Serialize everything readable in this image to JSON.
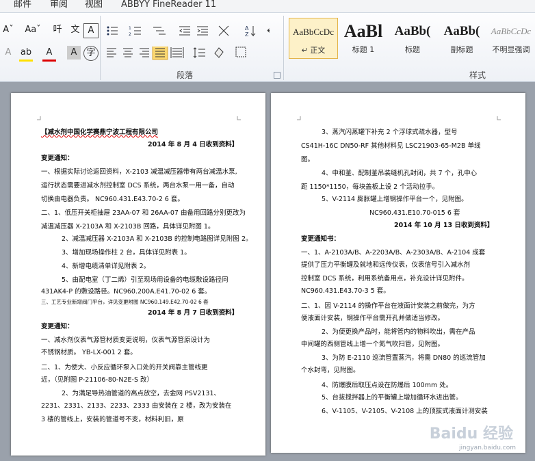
{
  "menu": [
    "邮件",
    "审阅",
    "视图",
    "ABBYY FineReader 11"
  ],
  "ribbon": {
    "font_row1": [
      "Aˇ",
      "Aaˇ",
      "吀",
      "文",
      "A"
    ],
    "font_row2": [
      "A",
      "ab",
      "A",
      "A",
      "字"
    ],
    "paragraph_label": "段落",
    "styles_label": "样式",
    "styles": [
      {
        "preview": "AaBbCcDc",
        "name": "↵ 正文"
      },
      {
        "preview": "AaBl",
        "name": "标题 1"
      },
      {
        "preview": "AaBb(",
        "name": "标题"
      },
      {
        "preview": "AaBb(",
        "name": "副标题"
      },
      {
        "preview": "AaBbCcDc",
        "name": "不明显强调"
      }
    ]
  },
  "left_page": {
    "lines": [
      "【减水剂中国化学赛鼎宁波工程有限公司",
      "2014 年 8 月 4 日收到资料】",
      "变更通知：",
      "一、根据实际讨论返回资料，X-2103 减温减压器带有两台减温水泵,",
      "运行状态需要进减水剂控制室 DCS 系统，两台水泵一用一备，自动",
      "切换由电器负责。            NC960.431.E43.70-2       6 套。",
      "二、1、低压开关柜抽屉 23AA-07 和 26AA-07 由备用回路分别更改为",
      "减温减压器 X-2103A 和 X-2103B 回路，具体详见附图 1。",
      "2、减温减压器 X-2103A 和 X-2103B 的控制电路图详见附图 2。",
      "3、增加现场操作柱 2 台，具体详见附表 1。",
      "4、新增电缆清单详见附表 2。",
      "5、由配电室（丁二烯）引至现场用设备的电缆敷设路径同",
      "431AK4-P 的敷设路径。NC960.200A.E41.70-02    6 套。",
      "三、工艺专业新增阀门平台，详见变更附图     NC960.149.E42.70-02   6 套",
      "2014 年 8 月 7 日收到资料】",
      "变更通知：",
      "一、减水剂仪表气源管材质变更说明，仪表气源管原设计为",
      "不锈钢材质。                YB-LX-001            2 套。",
      "二、1、为使大、小反应循环泵入口处的开关阀靠主管线更",
      "近，（见附图 P-21106-80-N2E-S 改）",
      "2、为满足导热油管道的高点放空，去金网  PSV2131、",
      "2231、2331、2133、2233、2333 由安装在 2 楼，改为安装在",
      "3  楼的管线上，安装的管道号不变，材料利旧，原"
    ]
  },
  "right_page": {
    "lines": [
      "3、蒸汽闪蒸罐下补充 2 个浮球式疏水器，型号",
      "CS41H-16C DN50-RF 其他材料见 LSC21903-65-M2B 单线",
      "图。",
      "4、中和釜、配制釜吊装缝机孔封闭，共 7 个，孔中心",
      "距 1150*1150，每块盖板上设 2 个活动拉手。",
      "5、V-2114 膨胀罐上增钢操作平台一个，见附图。",
      "NC960.431.E10.70-015            6 套",
      "2014 年 10 月 13 日收到资料】",
      "变更通知书：",
      "一、1、A-2103A/B、A-2203A/B、A-2303A/B、A-2104 成套",
      "提供了压力平衡罐及就地和远传仪表，仪表信号引入减水剂",
      "控制室  DCS  系统，利用系统备用点，补充设计详见附件。",
      "NC960.431.E43.70-3    5 套。",
      "二、1、因 V-2114 的操作平台在液面计安装之前做完，为方",
      "便液面计安装，钢操作平台需开孔并做适当修改。",
      "2、为便更换产品时，能将管内的物料吹出，需在产品",
      "中间罐的西侧管线上增一个氮气吹扫管，见附图。",
      "3、为防 E-2110 巡流管置蒸汽，将需 DN80 的巡流管加",
      "个水封弯，见附图。",
      "4、防爆膜后取压点设在防爆后 100mm 处。",
      "5、台拔搅拌器上的平衡罐上增加循环水进出管。",
      "6、V-1105、V-2105、V-2108 上的顶拔式液面计测安装"
    ]
  },
  "watermark": {
    "logo": "Baidu 经验",
    "url": "jingyan.baidu.com"
  }
}
